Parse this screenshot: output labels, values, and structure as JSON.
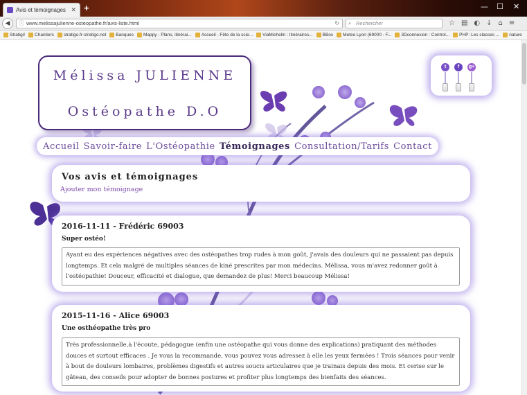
{
  "browser": {
    "tab_title": "Avis et témoignages",
    "url": "www.melissajulienne-osteopathe.fr/avis-liste.html",
    "search_placeholder": "Rechercher",
    "bookmarks": [
      "Stratigi!",
      "Chantiers",
      "stratigo.fr-stratigo.net",
      "Banques",
      "Mappy - Plans, itinérai...",
      "Accueil - Fête de la scie...",
      "ViaMichelin : Itinéraires...",
      "BBox",
      "Meteo Lyon (69000 - F...",
      "3Dconnexion : Control...",
      "PHP: Les classes ...",
      "nature"
    ]
  },
  "header": {
    "name": "Mélissa JULIENNE",
    "title": "Ostéopathe D.O"
  },
  "social": {
    "twitter": "t",
    "facebook": "f",
    "googleplus": "g+"
  },
  "nav": {
    "items": [
      "Accueil",
      "Savoir-faire",
      "L'Ostéopathie",
      "Témoignages",
      "Consultation/Tarifs",
      "Contact"
    ],
    "active": "Témoignages"
  },
  "page": {
    "heading": "Vos avis et témoignages",
    "add_link": "Ajouter mon témoignage"
  },
  "reviews": [
    {
      "header": "2016-11-11 - Frédéric 69003",
      "title": "Super ostéo!",
      "text": "Ayant eu des expériences négatives avec des ostéopathes trop rudes à mon goût, j'avais des douleurs qui ne passaient pas depuis longtemps. Et cela malgré de multiples séances de kiné prescrites par mon médecins. Mélissa, vous m'avez redonner goût à l'ostéopathie! Douceur, efficacité et dialogue, que demandez de plus! Merci beaucoup Mélissa!"
    },
    {
      "header": "2015-11-16 - Alice 69003",
      "title": "Une osthéopathe très pro",
      "text": "Très professionnelle,à l'écoute, pédagogue (enfin une ostéopathe qui vous donne des explications) pratiquant des méthodes douces et surtout efficaces . Je vous la recommande, vous pouvez vous adressez à elle les yeux fermées ! Trois séances pour venir à bout de douleurs lombaires, problèmes digestifs et autres soucis articulaires que je trainais depuis des mois. Et cerise sur le gâteau, des conseils pour adopter de bonnes postures et profiter plus longtemps des bienfaits des séances."
    }
  ]
}
